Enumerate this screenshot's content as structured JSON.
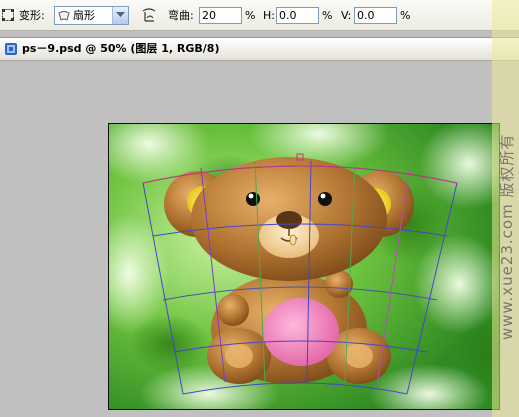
{
  "options_bar": {
    "warp_label": "变形:",
    "warp_style": "扇形",
    "bend_label": "弯曲:",
    "bend_value": "20",
    "bend_unit": "%",
    "h_label": "H:",
    "h_value": "0.0",
    "h_unit": "%",
    "v_label": "V:",
    "v_value": "0.0",
    "v_unit": "%"
  },
  "document": {
    "title": "ps－9.psd @ 50% (图层 1, RGB/8)"
  },
  "watermark": {
    "text": "www.xue23.com 版权所有"
  },
  "colors": {
    "warp_grid_line": "#5a5acc",
    "warp_grid_accent": "#cc3377",
    "bear_fur": "#a86a2a",
    "bear_belly": "#ee7fb8",
    "ear_inner": "#f3df3a"
  }
}
